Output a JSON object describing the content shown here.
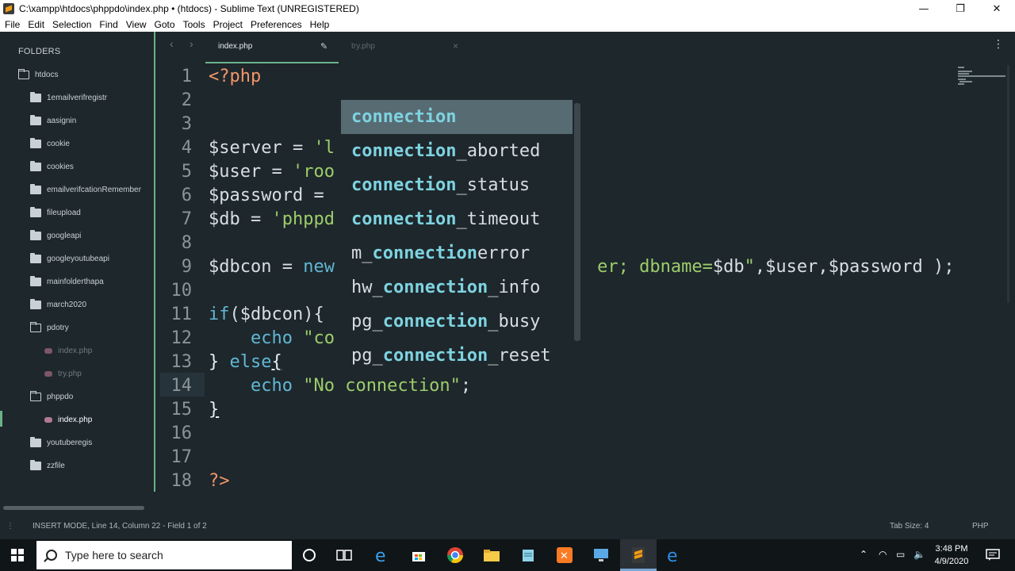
{
  "window": {
    "title": "C:\\xampp\\htdocs\\phppdo\\index.php • (htdocs) - Sublime Text (UNREGISTERED)",
    "minimize": "—",
    "maximize": "❐",
    "close": "✕"
  },
  "menu": [
    "File",
    "Edit",
    "Selection",
    "Find",
    "View",
    "Goto",
    "Tools",
    "Project",
    "Preferences",
    "Help"
  ],
  "sidebar": {
    "header": "FOLDERS",
    "items": [
      {
        "label": "htdocs",
        "icon": "folder-open-icon"
      },
      {
        "label": "1emailverifregistr",
        "icon": "folder-icon"
      },
      {
        "label": "aasignin",
        "icon": "folder-icon"
      },
      {
        "label": "cookie",
        "icon": "folder-icon"
      },
      {
        "label": "cookies",
        "icon": "folder-icon"
      },
      {
        "label": "emailverifcationRemember",
        "icon": "folder-icon"
      },
      {
        "label": "fileupload",
        "icon": "folder-icon"
      },
      {
        "label": "googleapi",
        "icon": "folder-icon"
      },
      {
        "label": "googleyoutubeapi",
        "icon": "folder-icon"
      },
      {
        "label": "mainfolderthapa",
        "icon": "folder-icon"
      },
      {
        "label": "march2020",
        "icon": "folder-icon"
      },
      {
        "label": "pdotry",
        "icon": "folder-open-icon"
      },
      {
        "label": "index.php",
        "icon": "php-file-icon"
      },
      {
        "label": "try.php",
        "icon": "php-file-icon"
      },
      {
        "label": "phppdo",
        "icon": "folder-open-icon"
      },
      {
        "label": "index.php",
        "icon": "php-file-icon"
      },
      {
        "label": "youtuberegis",
        "icon": "folder-icon"
      },
      {
        "label": "zzfile",
        "icon": "folder-icon"
      }
    ]
  },
  "tabs": {
    "back": "‹",
    "forward": "›",
    "active": "index.php",
    "inactive": "try.php",
    "edit_icon": "✎",
    "close_icon": "×",
    "more_icon": "⋮"
  },
  "editor": {
    "line_numbers": [
      "1",
      "2",
      "3",
      "4",
      "5",
      "6",
      "7",
      "8",
      "9",
      "10",
      "11",
      "12",
      "13",
      "14",
      "15",
      "16",
      "17",
      "18"
    ]
  },
  "autocomplete": {
    "items": [
      {
        "pre": "",
        "match": "connection",
        "post": ""
      },
      {
        "pre": "",
        "match": "connection",
        "post": "_aborted"
      },
      {
        "pre": "",
        "match": "connection",
        "post": "_status"
      },
      {
        "pre": "",
        "match": "connection",
        "post": "_timeout"
      },
      {
        "pre": "m_",
        "match": "connection",
        "post": "error"
      },
      {
        "pre": "hw_",
        "match": "connection",
        "post": "_info"
      },
      {
        "pre": "pg_",
        "match": "connection",
        "post": "_busy"
      },
      {
        "pre": "pg_",
        "match": "connection",
        "post": "_reset"
      }
    ]
  },
  "status": {
    "dots": "⋮",
    "left": "INSERT MODE, Line 14, Column 22 - Field 1 of 2",
    "tab_size": "Tab Size: 4",
    "syntax": "PHP"
  },
  "taskbar": {
    "search_placeholder": "Type here to search",
    "time": "3:48 PM",
    "date": "4/9/2020"
  }
}
